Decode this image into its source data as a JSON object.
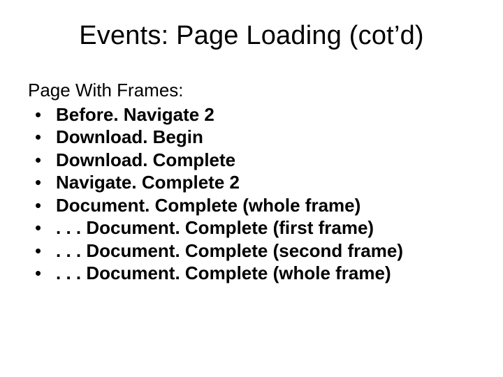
{
  "title": "Events: Page Loading (cot’d)",
  "lead": "Page With Frames:",
  "bullets": [
    "Before. Navigate 2",
    "Download. Begin",
    "Download. Complete",
    "Navigate. Complete 2",
    "Document. Complete (whole frame)",
    ". . . Document. Complete (first frame)",
    ". . . Document. Complete (second frame)",
    ". . . Document. Complete (whole frame)"
  ]
}
